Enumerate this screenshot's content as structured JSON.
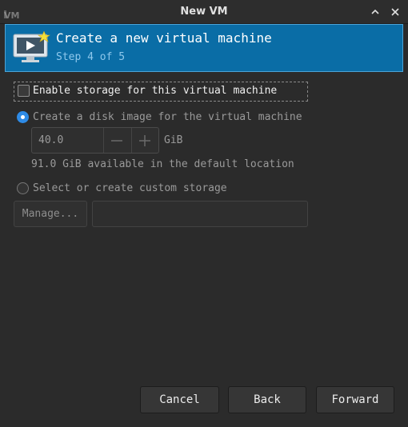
{
  "window": {
    "title": "New VM",
    "app_icon": "virt-manager-icon",
    "minimize_icon": "chevron-up-icon",
    "close_icon": "close-icon"
  },
  "header": {
    "icon": "monitor-with-star-icon",
    "title": "Create a new virtual machine",
    "step": "Step 4 of 5",
    "background_color": "#0a6da6"
  },
  "storage": {
    "enable_label": "Enable storage for this virtual machine",
    "enable_checked": false,
    "disk_image_label": "Create a disk image for the virtual machine",
    "disk_image_selected": true,
    "size_value": "40.0",
    "size_unit": "GiB",
    "available_text": "91.0 GiB available in the default location",
    "custom_label": "Select or create custom storage",
    "custom_selected": false,
    "manage_label": "Manage...",
    "custom_path_value": ""
  },
  "footer": {
    "cancel_label": "Cancel",
    "back_label": "Back",
    "forward_label": "Forward"
  }
}
